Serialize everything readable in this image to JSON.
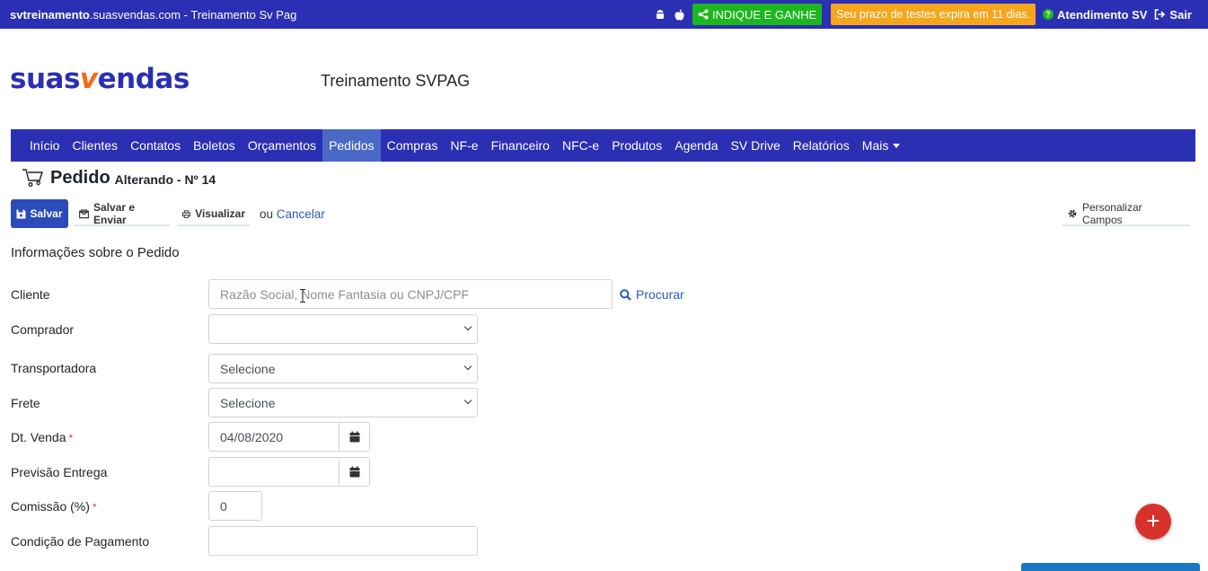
{
  "topbar": {
    "site_bold": "svtreinamento",
    "site_rest": ".suasvendas.com - Treinamento Sv Pag",
    "indique": "INDIQUE E GANHE",
    "prazo": "Seu prazo de testes expira em 11 dias.",
    "atendimento": "Atendimento SV",
    "sair": "Sair",
    "colors": {
      "bar": "#2a2fb3",
      "indique": "#1db71d",
      "prazo": "#f6a61b"
    }
  },
  "header": {
    "logo_a": "suas",
    "logo_v": "v",
    "logo_b": "endas",
    "company": "Treinamento SVPAG"
  },
  "nav": {
    "items": [
      "Início",
      "Clientes",
      "Contatos",
      "Boletos",
      "Orçamentos",
      "Pedidos",
      "Compras",
      "NF-e",
      "Financeiro",
      "NFC-e",
      "Produtos",
      "Agenda",
      "SV Drive",
      "Relatórios",
      "Mais"
    ],
    "active": "Pedidos"
  },
  "page": {
    "title": "Pedido",
    "subtitle": "Alterando - Nº 14"
  },
  "toolbar": {
    "salvar": "Salvar",
    "salvar_enviar": "Salvar e Enviar",
    "visualizar": "Visualizar",
    "ou": "ou",
    "cancelar": "Cancelar",
    "personalizar": "Personalizar Campos"
  },
  "section": {
    "title": "Informações sobre o Pedido"
  },
  "form": {
    "cliente": {
      "label": "Cliente",
      "placeholder": "Razão Social, Nome Fantasia ou CNPJ/CPF",
      "procurar": "Procurar"
    },
    "comprador": {
      "label": "Comprador",
      "value": ""
    },
    "transportadora": {
      "label": "Transportadora",
      "value": "Selecione"
    },
    "frete": {
      "label": "Frete",
      "value": "Selecione"
    },
    "dt_venda": {
      "label": "Dt. Venda",
      "required": "*",
      "value": "04/08/2020"
    },
    "previsao": {
      "label": "Previsão Entrega",
      "value": ""
    },
    "comissao": {
      "label": "Comissão (%)",
      "required": "*",
      "value": "0"
    },
    "condicao": {
      "label": "Condição de Pagamento",
      "value": ""
    }
  },
  "fab": {
    "label": "+"
  }
}
